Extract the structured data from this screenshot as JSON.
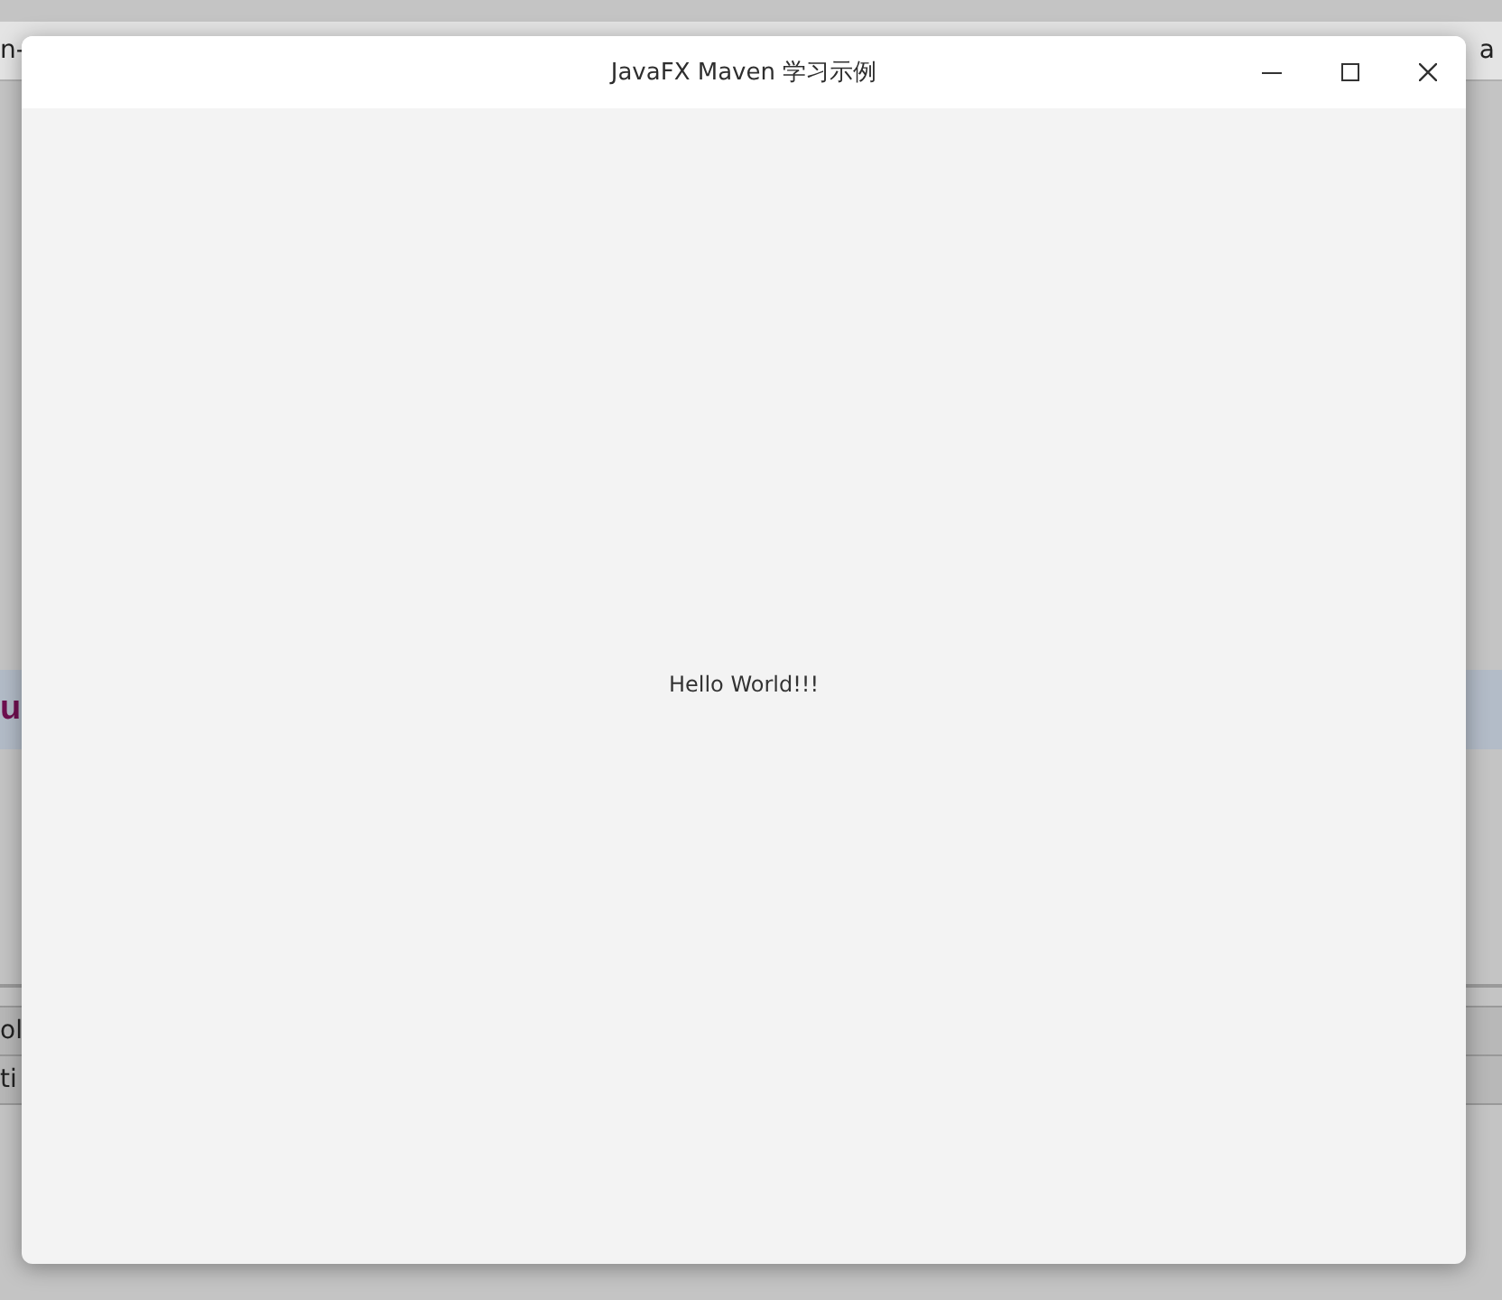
{
  "background": {
    "top_left": "n-",
    "top_right": "a",
    "banner_left": "u",
    "rows": [
      "ol",
      "ti"
    ]
  },
  "window": {
    "title": "JavaFX Maven 学习示例",
    "controls": [
      {
        "kind": "minimize"
      },
      {
        "kind": "maximize"
      },
      {
        "kind": "close"
      }
    ]
  },
  "content": {
    "label": "Hello World!!!"
  }
}
